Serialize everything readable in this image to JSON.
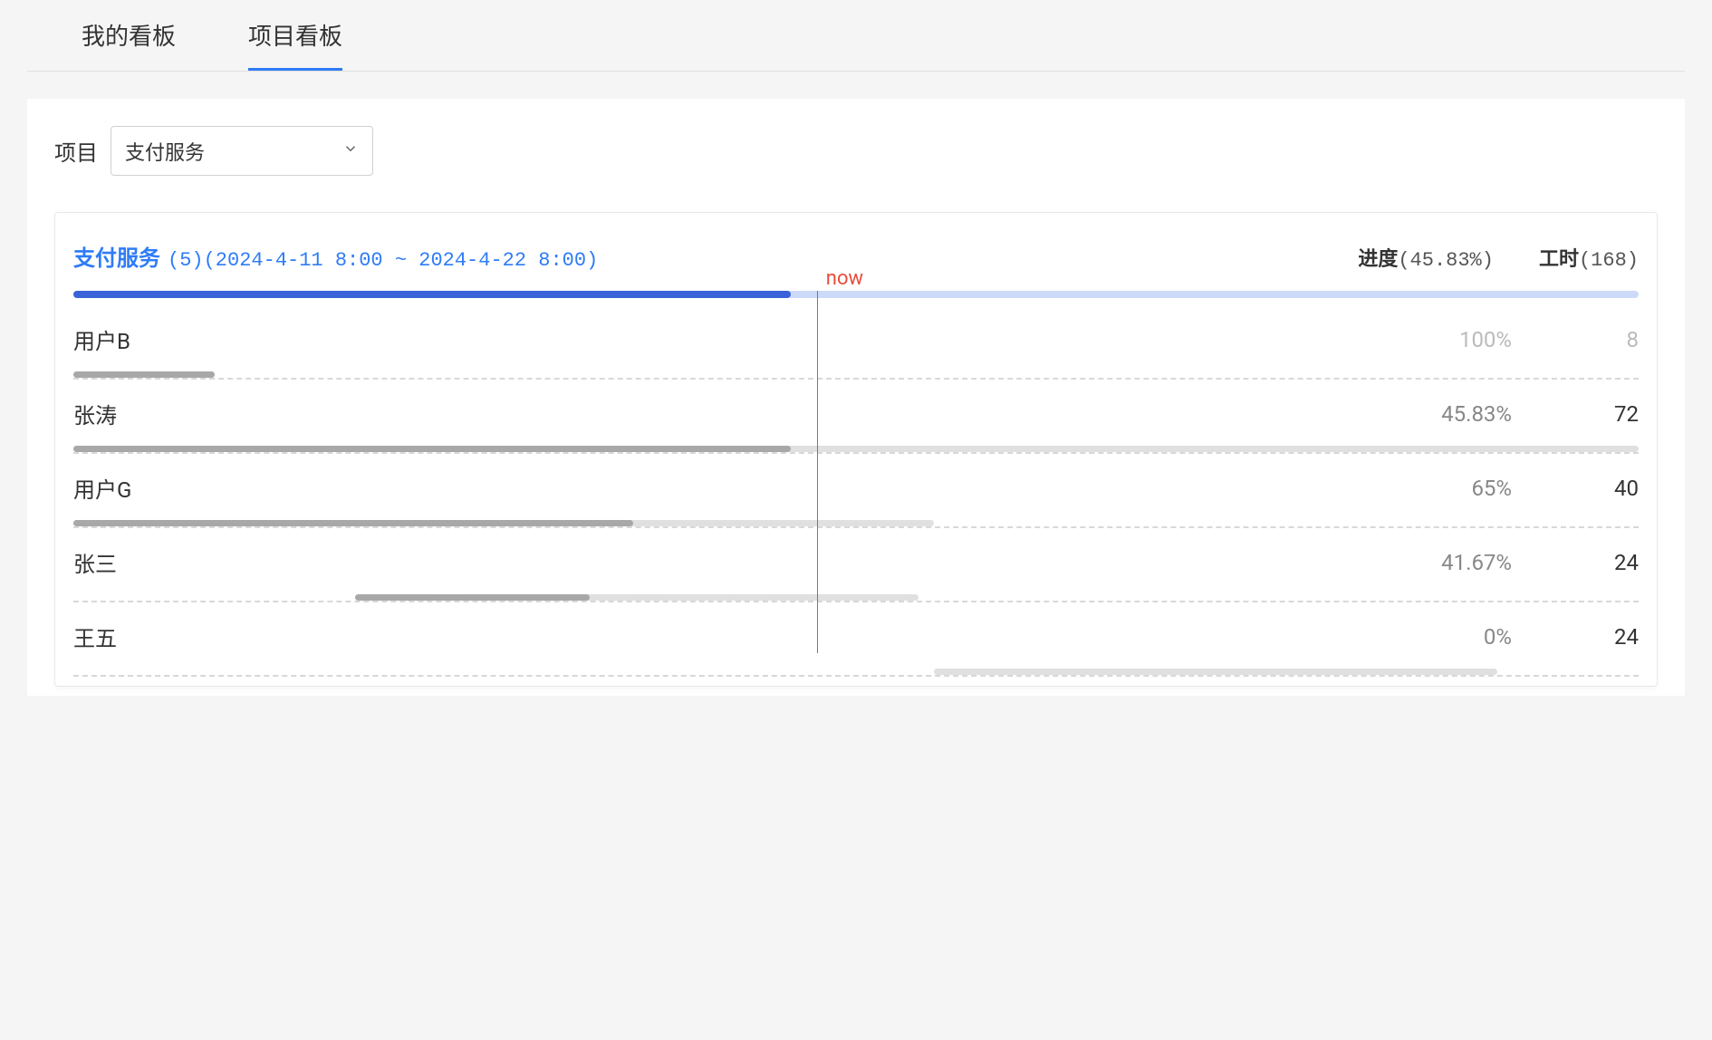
{
  "tabs": [
    {
      "label": "我的看板",
      "active": false
    },
    {
      "label": "项目看板",
      "active": true
    }
  ],
  "project_selector": {
    "label": "项目",
    "value": "支付服务"
  },
  "card": {
    "title": "支付服务",
    "subtitle": "(5)(2024-4-11 8:00 ~ 2024-4-22 8:00)",
    "progress_label": "进度",
    "progress_value": "(45.83%)",
    "hours_label": "工时",
    "hours_value": "(168)",
    "overall_progress_pct": 45.83,
    "now_label": "now",
    "now_position_pct": 47.5
  },
  "rows": [
    {
      "name": "用户B",
      "progress": "100%",
      "hours": "8",
      "bar_start_pct": 0,
      "bar_width_pct": 9,
      "fill_pct": 100
    },
    {
      "name": "张涛",
      "progress": "45.83%",
      "hours": "72",
      "bar_start_pct": 0,
      "bar_width_pct": 100,
      "fill_pct": 45.83
    },
    {
      "name": "用户G",
      "progress": "65%",
      "hours": "40",
      "bar_start_pct": 0,
      "bar_width_pct": 55,
      "fill_pct": 65
    },
    {
      "name": "张三",
      "progress": "41.67%",
      "hours": "24",
      "bar_start_pct": 18,
      "bar_width_pct": 36,
      "fill_pct": 41.67
    },
    {
      "name": "王五",
      "progress": "0%",
      "hours": "24",
      "bar_start_pct": 55,
      "bar_width_pct": 36,
      "fill_pct": 0
    }
  ],
  "chart_data": {
    "type": "bar",
    "title": "支付服务 进度/工时",
    "x_range": "2024-4-11 8:00 ~ 2024-4-22 8:00",
    "overall_progress": 45.83,
    "total_hours": 168,
    "now_position_pct": 47.5,
    "series": [
      {
        "name": "用户B",
        "progress_pct": 100,
        "hours": 8,
        "start_pct": 0,
        "span_pct": 9
      },
      {
        "name": "张涛",
        "progress_pct": 45.83,
        "hours": 72,
        "start_pct": 0,
        "span_pct": 100
      },
      {
        "name": "用户G",
        "progress_pct": 65,
        "hours": 40,
        "start_pct": 0,
        "span_pct": 55
      },
      {
        "name": "张三",
        "progress_pct": 41.67,
        "hours": 24,
        "start_pct": 18,
        "span_pct": 36
      },
      {
        "name": "王五",
        "progress_pct": 0,
        "hours": 24,
        "start_pct": 55,
        "span_pct": 36
      }
    ]
  }
}
